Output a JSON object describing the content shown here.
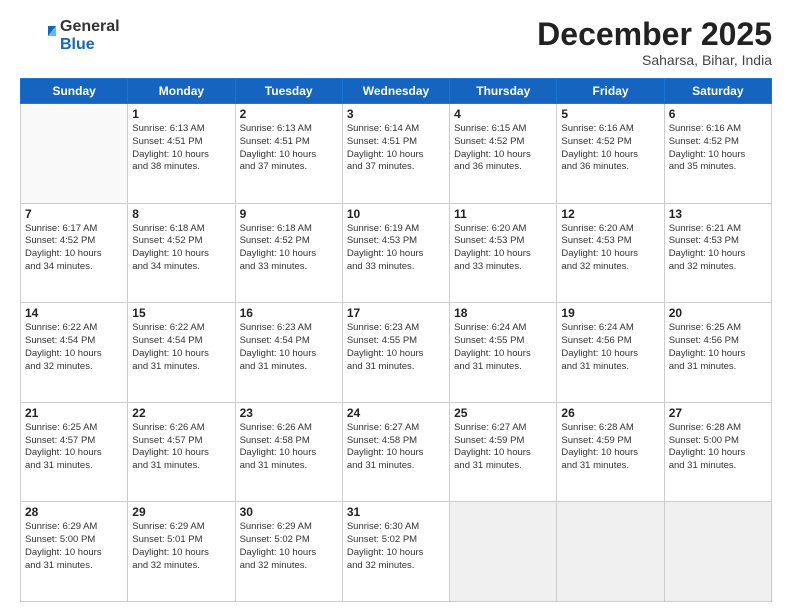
{
  "header": {
    "logo_general": "General",
    "logo_blue": "Blue",
    "month_title": "December 2025",
    "location": "Saharsa, Bihar, India"
  },
  "days_of_week": [
    "Sunday",
    "Monday",
    "Tuesday",
    "Wednesday",
    "Thursday",
    "Friday",
    "Saturday"
  ],
  "weeks": [
    [
      {
        "num": "",
        "empty": true
      },
      {
        "num": "1",
        "sunrise": "6:13 AM",
        "sunset": "4:51 PM",
        "daylight": "10 hours and 38 minutes."
      },
      {
        "num": "2",
        "sunrise": "6:13 AM",
        "sunset": "4:51 PM",
        "daylight": "10 hours and 37 minutes."
      },
      {
        "num": "3",
        "sunrise": "6:14 AM",
        "sunset": "4:51 PM",
        "daylight": "10 hours and 37 minutes."
      },
      {
        "num": "4",
        "sunrise": "6:15 AM",
        "sunset": "4:52 PM",
        "daylight": "10 hours and 36 minutes."
      },
      {
        "num": "5",
        "sunrise": "6:16 AM",
        "sunset": "4:52 PM",
        "daylight": "10 hours and 36 minutes."
      },
      {
        "num": "6",
        "sunrise": "6:16 AM",
        "sunset": "4:52 PM",
        "daylight": "10 hours and 35 minutes."
      }
    ],
    [
      {
        "num": "7",
        "sunrise": "6:17 AM",
        "sunset": "4:52 PM",
        "daylight": "10 hours and 34 minutes."
      },
      {
        "num": "8",
        "sunrise": "6:18 AM",
        "sunset": "4:52 PM",
        "daylight": "10 hours and 34 minutes."
      },
      {
        "num": "9",
        "sunrise": "6:18 AM",
        "sunset": "4:52 PM",
        "daylight": "10 hours and 33 minutes."
      },
      {
        "num": "10",
        "sunrise": "6:19 AM",
        "sunset": "4:53 PM",
        "daylight": "10 hours and 33 minutes."
      },
      {
        "num": "11",
        "sunrise": "6:20 AM",
        "sunset": "4:53 PM",
        "daylight": "10 hours and 33 minutes."
      },
      {
        "num": "12",
        "sunrise": "6:20 AM",
        "sunset": "4:53 PM",
        "daylight": "10 hours and 32 minutes."
      },
      {
        "num": "13",
        "sunrise": "6:21 AM",
        "sunset": "4:53 PM",
        "daylight": "10 hours and 32 minutes."
      }
    ],
    [
      {
        "num": "14",
        "sunrise": "6:22 AM",
        "sunset": "4:54 PM",
        "daylight": "10 hours and 32 minutes."
      },
      {
        "num": "15",
        "sunrise": "6:22 AM",
        "sunset": "4:54 PM",
        "daylight": "10 hours and 31 minutes."
      },
      {
        "num": "16",
        "sunrise": "6:23 AM",
        "sunset": "4:54 PM",
        "daylight": "10 hours and 31 minutes."
      },
      {
        "num": "17",
        "sunrise": "6:23 AM",
        "sunset": "4:55 PM",
        "daylight": "10 hours and 31 minutes."
      },
      {
        "num": "18",
        "sunrise": "6:24 AM",
        "sunset": "4:55 PM",
        "daylight": "10 hours and 31 minutes."
      },
      {
        "num": "19",
        "sunrise": "6:24 AM",
        "sunset": "4:56 PM",
        "daylight": "10 hours and 31 minutes."
      },
      {
        "num": "20",
        "sunrise": "6:25 AM",
        "sunset": "4:56 PM",
        "daylight": "10 hours and 31 minutes."
      }
    ],
    [
      {
        "num": "21",
        "sunrise": "6:25 AM",
        "sunset": "4:57 PM",
        "daylight": "10 hours and 31 minutes."
      },
      {
        "num": "22",
        "sunrise": "6:26 AM",
        "sunset": "4:57 PM",
        "daylight": "10 hours and 31 minutes."
      },
      {
        "num": "23",
        "sunrise": "6:26 AM",
        "sunset": "4:58 PM",
        "daylight": "10 hours and 31 minutes."
      },
      {
        "num": "24",
        "sunrise": "6:27 AM",
        "sunset": "4:58 PM",
        "daylight": "10 hours and 31 minutes."
      },
      {
        "num": "25",
        "sunrise": "6:27 AM",
        "sunset": "4:59 PM",
        "daylight": "10 hours and 31 minutes."
      },
      {
        "num": "26",
        "sunrise": "6:28 AM",
        "sunset": "4:59 PM",
        "daylight": "10 hours and 31 minutes."
      },
      {
        "num": "27",
        "sunrise": "6:28 AM",
        "sunset": "5:00 PM",
        "daylight": "10 hours and 31 minutes."
      }
    ],
    [
      {
        "num": "28",
        "sunrise": "6:29 AM",
        "sunset": "5:00 PM",
        "daylight": "10 hours and 31 minutes."
      },
      {
        "num": "29",
        "sunrise": "6:29 AM",
        "sunset": "5:01 PM",
        "daylight": "10 hours and 32 minutes."
      },
      {
        "num": "30",
        "sunrise": "6:29 AM",
        "sunset": "5:02 PM",
        "daylight": "10 hours and 32 minutes."
      },
      {
        "num": "31",
        "sunrise": "6:30 AM",
        "sunset": "5:02 PM",
        "daylight": "10 hours and 32 minutes."
      },
      {
        "num": "",
        "empty": true
      },
      {
        "num": "",
        "empty": true
      },
      {
        "num": "",
        "empty": true
      }
    ]
  ],
  "labels": {
    "sunrise": "Sunrise:",
    "sunset": "Sunset:",
    "daylight": "Daylight:"
  }
}
